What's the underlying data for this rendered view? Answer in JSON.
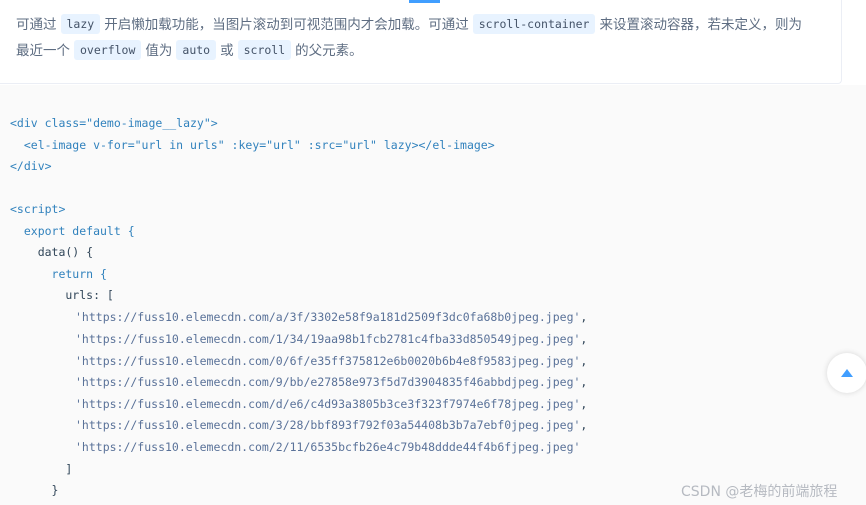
{
  "description": {
    "line1": {
      "t1": "可通过",
      "chip1": "lazy",
      "t2": "开启懒加载功能，当图片滚动到可视范围内才会加载。可通过",
      "chip2": "scroll-container",
      "t3": "来设置滚动容器，若未定义，则为"
    },
    "line2": {
      "t1": "最近一个",
      "chip1": "overflow",
      "t2": "值为",
      "chip2": "auto",
      "t3": "或",
      "chip3": "scroll",
      "t4": "的父元素。"
    }
  },
  "code": {
    "line1": "<div class=\"demo-image__lazy\">",
    "line2": "  <el-image v-for=\"url in urls\" :key=\"url\" :src=\"url\" lazy></el-image>",
    "line3": "</div>",
    "line4": "<script>",
    "line5": "  export default {",
    "line6": "    data() {",
    "line7": "      return {",
    "line8": "        urls: [",
    "urls": [
      "'https://fuss10.elemecdn.com/a/3f/3302e58f9a181d2509f3dc0fa68b0jpeg.jpeg'",
      "'https://fuss10.elemecdn.com/1/34/19aa98b1fcb2781c4fba33d850549jpeg.jpeg'",
      "'https://fuss10.elemecdn.com/0/6f/e35ff375812e6b0020b6b4e8f9583jpeg.jpeg'",
      "'https://fuss10.elemecdn.com/9/bb/e27858e973f5d7d3904835f46abbdjpeg.jpeg'",
      "'https://fuss10.elemecdn.com/d/e6/c4d93a3805b3ce3f323f7974e6f78jpeg.jpeg'",
      "'https://fuss10.elemecdn.com/3/28/bbf893f792f03a54408b3b7a7ebf0jpeg.jpeg'",
      "'https://fuss10.elemecdn.com/2/11/6535bcfb26e4c79b48ddde44f4b6fjpeg.jpeg'"
    ],
    "comma": ",",
    "close_bracket": "        ]",
    "close_brace": "      }"
  },
  "watermark": "CSDN @老梅的前端旅程",
  "icons": {
    "scroll_top": "caret-up-icon"
  },
  "colors": {
    "accent": "#409eff",
    "code_keyword": "#3182bd",
    "chip_bg": "#e8f3ff"
  }
}
